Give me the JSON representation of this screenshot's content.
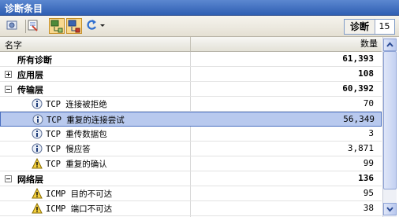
{
  "window": {
    "title": "诊断条目"
  },
  "toolbar": {
    "buttons": [
      {
        "icon": "properties-icon"
      },
      {
        "icon": "filter-icon"
      },
      {
        "icon": "collapse-icon",
        "pressed": true
      },
      {
        "icon": "expand-icon",
        "pressed": true
      },
      {
        "icon": "refresh-icon"
      }
    ],
    "diag_label": "诊断",
    "diag_count": "15"
  },
  "table": {
    "columns": {
      "name": "名字",
      "count": "数量"
    },
    "rows": [
      {
        "label": "所有诊断",
        "value": "61,393",
        "level": 0,
        "bold": true,
        "expander": "none",
        "icon": "none"
      },
      {
        "label": "应用层",
        "value": "108",
        "level": 0,
        "bold": true,
        "expander": "plus",
        "icon": "none"
      },
      {
        "label": "传输层",
        "value": "60,392",
        "level": 0,
        "bold": true,
        "expander": "minus",
        "icon": "none"
      },
      {
        "label": "TCP 连接被拒绝",
        "value": "70",
        "level": 1,
        "icon": "info-icon"
      },
      {
        "label": "TCP 重复的连接尝试",
        "value": "56,349",
        "level": 1,
        "icon": "info-icon",
        "selected": true
      },
      {
        "label": "TCP 重传数据包",
        "value": "3",
        "level": 1,
        "icon": "info-icon"
      },
      {
        "label": "TCP 慢应答",
        "value": "3,871",
        "level": 1,
        "icon": "info-icon"
      },
      {
        "label": "TCP 重复的确认",
        "value": "99",
        "level": 1,
        "icon": "warning-icon"
      },
      {
        "label": "网络层",
        "value": "136",
        "level": 0,
        "bold": true,
        "expander": "minus",
        "icon": "none"
      },
      {
        "label": "ICMP 目的不可达",
        "value": "95",
        "level": 1,
        "icon": "warning-icon"
      },
      {
        "label": "ICMP 端口不可达",
        "value": "38",
        "level": 1,
        "icon": "warning-icon"
      }
    ]
  },
  "colors": {
    "title_bar": "#2f5fb3",
    "selection": "#b8c9ee",
    "pressed_button": "#f8d88f"
  }
}
